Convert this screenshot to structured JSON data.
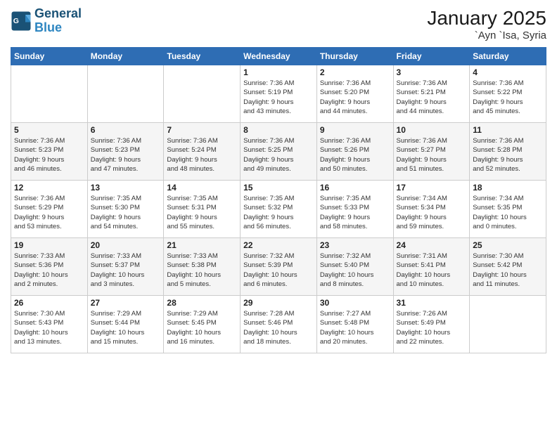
{
  "logo": {
    "line1": "General",
    "line2": "Blue"
  },
  "title": "January 2025",
  "location": "`Ayn `Isa, Syria",
  "weekdays": [
    "Sunday",
    "Monday",
    "Tuesday",
    "Wednesday",
    "Thursday",
    "Friday",
    "Saturday"
  ],
  "weeks": [
    [
      {
        "day": "",
        "info": ""
      },
      {
        "day": "",
        "info": ""
      },
      {
        "day": "",
        "info": ""
      },
      {
        "day": "1",
        "info": "Sunrise: 7:36 AM\nSunset: 5:19 PM\nDaylight: 9 hours\nand 43 minutes."
      },
      {
        "day": "2",
        "info": "Sunrise: 7:36 AM\nSunset: 5:20 PM\nDaylight: 9 hours\nand 44 minutes."
      },
      {
        "day": "3",
        "info": "Sunrise: 7:36 AM\nSunset: 5:21 PM\nDaylight: 9 hours\nand 44 minutes."
      },
      {
        "day": "4",
        "info": "Sunrise: 7:36 AM\nSunset: 5:22 PM\nDaylight: 9 hours\nand 45 minutes."
      }
    ],
    [
      {
        "day": "5",
        "info": "Sunrise: 7:36 AM\nSunset: 5:23 PM\nDaylight: 9 hours\nand 46 minutes."
      },
      {
        "day": "6",
        "info": "Sunrise: 7:36 AM\nSunset: 5:23 PM\nDaylight: 9 hours\nand 47 minutes."
      },
      {
        "day": "7",
        "info": "Sunrise: 7:36 AM\nSunset: 5:24 PM\nDaylight: 9 hours\nand 48 minutes."
      },
      {
        "day": "8",
        "info": "Sunrise: 7:36 AM\nSunset: 5:25 PM\nDaylight: 9 hours\nand 49 minutes."
      },
      {
        "day": "9",
        "info": "Sunrise: 7:36 AM\nSunset: 5:26 PM\nDaylight: 9 hours\nand 50 minutes."
      },
      {
        "day": "10",
        "info": "Sunrise: 7:36 AM\nSunset: 5:27 PM\nDaylight: 9 hours\nand 51 minutes."
      },
      {
        "day": "11",
        "info": "Sunrise: 7:36 AM\nSunset: 5:28 PM\nDaylight: 9 hours\nand 52 minutes."
      }
    ],
    [
      {
        "day": "12",
        "info": "Sunrise: 7:36 AM\nSunset: 5:29 PM\nDaylight: 9 hours\nand 53 minutes."
      },
      {
        "day": "13",
        "info": "Sunrise: 7:35 AM\nSunset: 5:30 PM\nDaylight: 9 hours\nand 54 minutes."
      },
      {
        "day": "14",
        "info": "Sunrise: 7:35 AM\nSunset: 5:31 PM\nDaylight: 9 hours\nand 55 minutes."
      },
      {
        "day": "15",
        "info": "Sunrise: 7:35 AM\nSunset: 5:32 PM\nDaylight: 9 hours\nand 56 minutes."
      },
      {
        "day": "16",
        "info": "Sunrise: 7:35 AM\nSunset: 5:33 PM\nDaylight: 9 hours\nand 58 minutes."
      },
      {
        "day": "17",
        "info": "Sunrise: 7:34 AM\nSunset: 5:34 PM\nDaylight: 9 hours\nand 59 minutes."
      },
      {
        "day": "18",
        "info": "Sunrise: 7:34 AM\nSunset: 5:35 PM\nDaylight: 10 hours\nand 0 minutes."
      }
    ],
    [
      {
        "day": "19",
        "info": "Sunrise: 7:33 AM\nSunset: 5:36 PM\nDaylight: 10 hours\nand 2 minutes."
      },
      {
        "day": "20",
        "info": "Sunrise: 7:33 AM\nSunset: 5:37 PM\nDaylight: 10 hours\nand 3 minutes."
      },
      {
        "day": "21",
        "info": "Sunrise: 7:33 AM\nSunset: 5:38 PM\nDaylight: 10 hours\nand 5 minutes."
      },
      {
        "day": "22",
        "info": "Sunrise: 7:32 AM\nSunset: 5:39 PM\nDaylight: 10 hours\nand 6 minutes."
      },
      {
        "day": "23",
        "info": "Sunrise: 7:32 AM\nSunset: 5:40 PM\nDaylight: 10 hours\nand 8 minutes."
      },
      {
        "day": "24",
        "info": "Sunrise: 7:31 AM\nSunset: 5:41 PM\nDaylight: 10 hours\nand 10 minutes."
      },
      {
        "day": "25",
        "info": "Sunrise: 7:30 AM\nSunset: 5:42 PM\nDaylight: 10 hours\nand 11 minutes."
      }
    ],
    [
      {
        "day": "26",
        "info": "Sunrise: 7:30 AM\nSunset: 5:43 PM\nDaylight: 10 hours\nand 13 minutes."
      },
      {
        "day": "27",
        "info": "Sunrise: 7:29 AM\nSunset: 5:44 PM\nDaylight: 10 hours\nand 15 minutes."
      },
      {
        "day": "28",
        "info": "Sunrise: 7:29 AM\nSunset: 5:45 PM\nDaylight: 10 hours\nand 16 minutes."
      },
      {
        "day": "29",
        "info": "Sunrise: 7:28 AM\nSunset: 5:46 PM\nDaylight: 10 hours\nand 18 minutes."
      },
      {
        "day": "30",
        "info": "Sunrise: 7:27 AM\nSunset: 5:48 PM\nDaylight: 10 hours\nand 20 minutes."
      },
      {
        "day": "31",
        "info": "Sunrise: 7:26 AM\nSunset: 5:49 PM\nDaylight: 10 hours\nand 22 minutes."
      },
      {
        "day": "",
        "info": ""
      }
    ]
  ]
}
